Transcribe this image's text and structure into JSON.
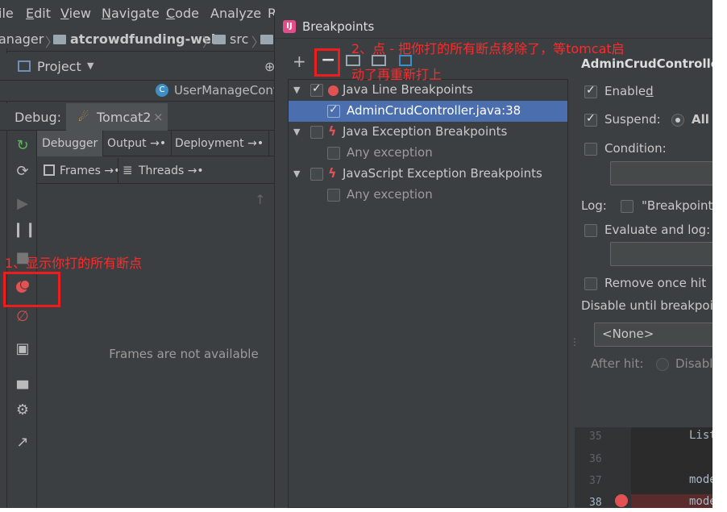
{
  "menu": {
    "items": [
      "ile",
      "Edit",
      "View",
      "Navigate",
      "Code",
      "Analyze",
      "R"
    ],
    "mnemonic": [
      null,
      "E",
      "V",
      "N",
      "C",
      null,
      null
    ]
  },
  "nav": {
    "crumb_1": "anager",
    "crumb_2": "atcrowdfunding-web",
    "crumb_3": "src"
  },
  "project": {
    "label": "Project",
    "open_file": "UserManageCont"
  },
  "debug": {
    "label": "Debug:",
    "config": "Tomcat2",
    "tabs": {
      "debugger": "Debugger",
      "output": "Output",
      "deployment": "Deployment"
    },
    "frames_label": "Frames",
    "threads_label": "Threads",
    "empty": "Frames are not available"
  },
  "dialog": {
    "title": "Breakpoints",
    "toolbar": {
      "add": "+",
      "remove": "−"
    },
    "tree": [
      {
        "label": "Java Line Breakpoints",
        "checked": true
      },
      {
        "label": "AdminCrudController.java:38",
        "checked": true
      },
      {
        "label": "Java Exception Breakpoints",
        "checked": false
      },
      {
        "label": "Any exception",
        "checked": false
      },
      {
        "label": "JavaScript Exception Breakpoints",
        "checked": false
      },
      {
        "label": "Any exception",
        "checked": false
      }
    ],
    "detail": {
      "header": "AdminCrudController.",
      "enabled": "Enabled",
      "suspend": "Suspend:",
      "suspend_all": "All",
      "condition": "Condition:",
      "log": "Log:",
      "log_breakpoint": "\"Breakpoint",
      "evaluate": "Evaluate and log:",
      "remove_once": "Remove once hit",
      "disable_until": "Disable until breakpoir",
      "none_option": "<None>",
      "after_hit": "After hit:",
      "disable": "Disable"
    },
    "code": {
      "lines": [
        "35",
        "36",
        "37",
        "38"
      ],
      "text": [
        "List",
        "",
        "mode",
        "mode"
      ]
    }
  },
  "annotations": {
    "step1": "1、显示你打的所有断点",
    "step2_line1": "2、点 - 把你打的所有断点移除了，等tomcat启",
    "step2_line2": "动了再重新打上"
  },
  "colors": {
    "ide_bg": "#3c3f41",
    "selection": "#4b6eaf",
    "breakpoint_red": "#e35252",
    "annotation_red": "#ff2a2a"
  }
}
